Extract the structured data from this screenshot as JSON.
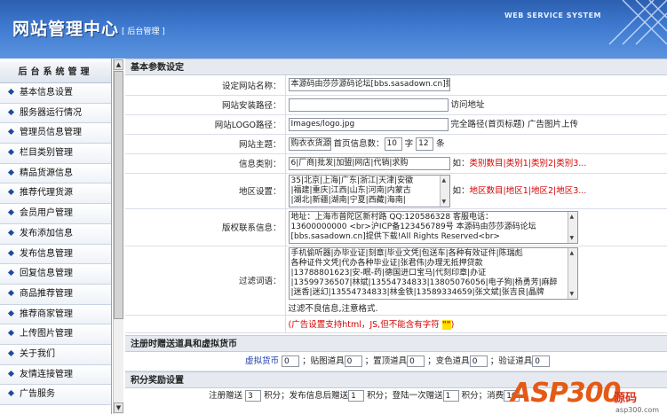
{
  "header": {
    "title": "网站管理中心",
    "subtitle": "[ 后台管理 ]",
    "service_text": "WEB SERVICE SYSTEM"
  },
  "sidebar": {
    "heading": "后台系统管理",
    "items": [
      {
        "label": "基本信息设置"
      },
      {
        "label": "服务器运行情况"
      },
      {
        "label": "管理员信息管理"
      },
      {
        "label": "栏目类别管理"
      },
      {
        "label": "精品货源信息"
      },
      {
        "label": "推荐代理货源"
      },
      {
        "label": "会员用户管理"
      },
      {
        "label": "发布添加信息"
      },
      {
        "label": "发布信息管理"
      },
      {
        "label": "回复信息管理"
      },
      {
        "label": "商品推荐管理"
      },
      {
        "label": "推荐商家管理"
      },
      {
        "label": "上传图片管理"
      },
      {
        "label": "关于我们"
      },
      {
        "label": "友情连接管理"
      },
      {
        "label": "广告服务"
      }
    ]
  },
  "main": {
    "section_basic": "基本参数设定",
    "site_name_label": "设定网站名称：",
    "site_name_value": "本源码由莎莎源码论坛[bbs.sasadown.cn]提供",
    "install_path_label": "网站安装路径：",
    "install_path_value": "",
    "install_path_hint": "访问地址",
    "logo_label": "网站LOGO路径：",
    "logo_value": "Images/logo.jpg",
    "logo_hint": "完全路径(首页标题)   广告图片上传",
    "theme_label": "网站主题：",
    "theme_value": "购衣衣货源",
    "per_page_label": "首页信息数：",
    "per_page_value": "10",
    "per_page_unit": "字",
    "per_page_value2": "12",
    "per_page_unit2": "条",
    "category_label": "信息类别：",
    "category_value": "6|厂商|批发|加盟|网店|代销|求购",
    "category_hint_prefix": "如：",
    "category_hint": "类别数目|类别1|类别2|类别3...",
    "region_label": "地区设置：",
    "region_lines": [
      "35|北京|上海|广东|浙江|天津|安徽",
      "|福建|重庆|江西|山东|河南|内蒙古",
      "|湖北|新疆|湖南|宁夏|西藏|海南|"
    ],
    "region_hint_prefix": "如：",
    "region_hint": "地区数目|地区1|地区2|地区3...",
    "copyright_label": "版权联系信息：",
    "copyright_lines": [
      "地址：上海市普陀区新村路    QQ:120586328  客服电话：",
      "13600000000 <br>沪ICP备123456789号 本源码由莎莎源码论坛",
      "[bbs.sasadown.cn]提供下载!All Rights Reserved<br>"
    ],
    "filter_label": "过滤词语：",
    "filter_lines": [
      "手机偷听器|办毕业证|刻章|毕业文凭|包送车|各种有效证件|陈瑞彪",
      "各种证件文凭|代办各种毕业证|张君伟|办理无抵押贷款",
      "|13788801623|安-眠-药|德国进口宝马|代刻印章|办证",
      "|13599736507|林斌|13554734833|13805076056|电子狗|杨勇芳|麻醉",
      "|迷香|迷幻|13554734833|林金铁|13589334659|张文斌|张吉良|晶牌"
    ],
    "filter_note": "过滤不良信息,注意格式.",
    "ad_note_prefix": "(广告设置支持html，JS,但不能含有字符 ",
    "ad_note_char": "\"\"",
    "ad_note_suffix": ")",
    "section_register": "注册时赠送道具和虚拟货币",
    "reg_currency_label": "虚拟货币",
    "reg_currency_value": "0",
    "reg_tie_label": "；贴图道具",
    "reg_tie_value": "0",
    "reg_top_label": "；置顶道具",
    "reg_top_value": "0",
    "reg_color_label": "；变色道具",
    "reg_color_value": "0",
    "reg_verify_label": "；验证道具",
    "reg_verify_value": "0",
    "section_points": "积分奖励设置",
    "points_reg_label": "注册赠送",
    "points_reg_value": "3",
    "points_post_label": "积分；发布信息后赠送",
    "points_post_value": "1",
    "points_login_label": "积分；登陆一次赠送",
    "points_login_value": "1",
    "points_consume_label": "积分；消费",
    "points_consume_value": "10"
  },
  "watermark": {
    "brand": "ASP300",
    "cn": "源码",
    "url": "asp300.com"
  }
}
